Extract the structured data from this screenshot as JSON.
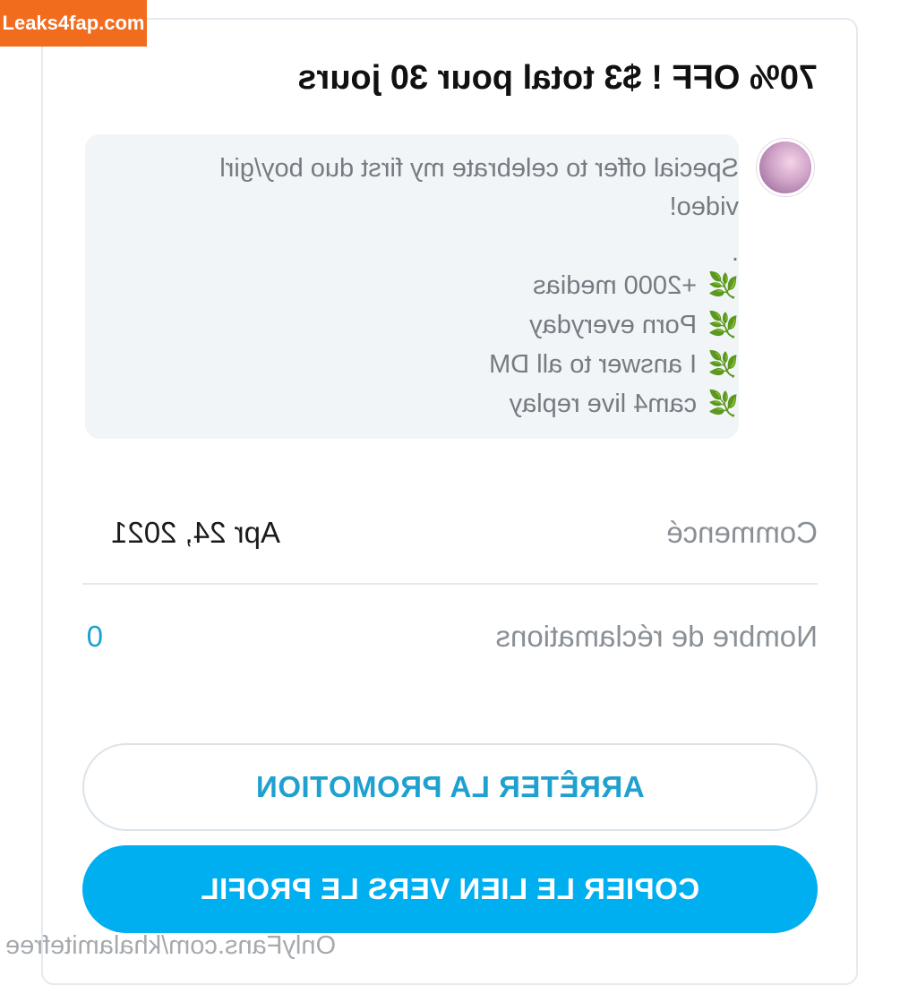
{
  "watermark": "Leaks4fap.com",
  "promo": {
    "title": "70% OFF ! $3 total pour 30 jours",
    "description_line1": "Special offer to celebrate my first duo boy/girl",
    "description_line2": "video!",
    "separator": ".",
    "features": [
      {
        "icon": "herb-icon",
        "label": "+2000 medias"
      },
      {
        "icon": "herb-icon",
        "label": "Porn everyday"
      },
      {
        "icon": "herb-icon",
        "label": "I answer to all DM"
      },
      {
        "icon": "herb-icon",
        "label": "cam4 live replay"
      }
    ]
  },
  "details": {
    "started_label": "Commencé",
    "started_value": "Apr 24, 2021",
    "claims_label": "Nombre de réclamations",
    "claims_value": "0"
  },
  "buttons": {
    "stop": "ARRÊTER LA PROMOTION",
    "copy": "COPIER LE LIEN VERS LE PROFIL"
  },
  "footer": "OnlyFans.com/khalamitefree",
  "colors": {
    "accent": "#00aff0",
    "accent_text": "#1ea1cf",
    "watermark_bg": "#f26c1e"
  }
}
